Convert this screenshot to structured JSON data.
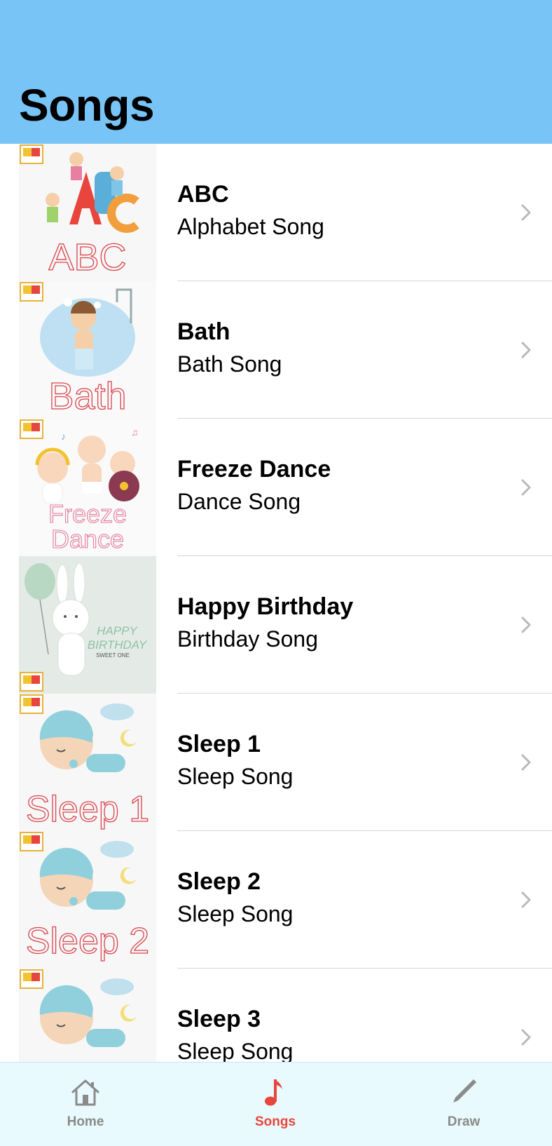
{
  "header": {
    "title": "Songs"
  },
  "colors": {
    "header_bg": "#78c4f6",
    "tabbar_bg": "#e8fafd",
    "active_tab": "#e8453c",
    "inactive_tab": "#8a8a8a"
  },
  "songs": [
    {
      "title": "ABC",
      "subtitle": "Alphabet Song",
      "thumb_text": "ABC"
    },
    {
      "title": "Bath",
      "subtitle": "Bath Song",
      "thumb_text": "Bath"
    },
    {
      "title": "Freeze Dance",
      "subtitle": "Dance Song",
      "thumb_text": "Freeze Dance"
    },
    {
      "title": "Happy Birthday",
      "subtitle": "Birthday Song",
      "thumb_text": "HAPPY BIRTHDAY SWEET ONE"
    },
    {
      "title": "Sleep 1",
      "subtitle": "Sleep Song",
      "thumb_text": "Sleep 1"
    },
    {
      "title": "Sleep 2",
      "subtitle": "Sleep Song",
      "thumb_text": "Sleep 2"
    },
    {
      "title": "Sleep 3",
      "subtitle": "Sleep Song",
      "thumb_text": ""
    }
  ],
  "tabs": [
    {
      "label": "Home",
      "icon": "house-icon",
      "active": false
    },
    {
      "label": "Songs",
      "icon": "music-note-icon",
      "active": true
    },
    {
      "label": "Draw",
      "icon": "pencil-icon",
      "active": false
    }
  ]
}
